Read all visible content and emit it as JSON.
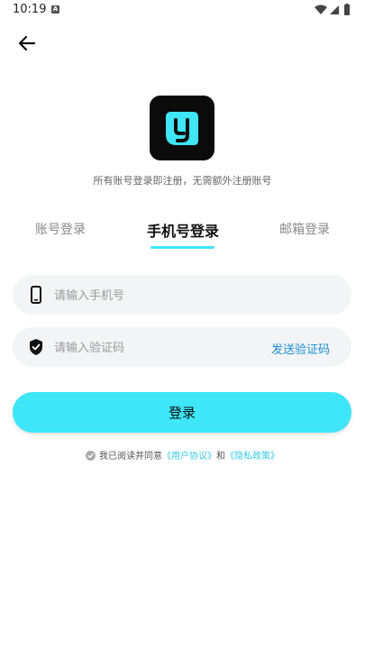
{
  "status_bar": {
    "time": "10:19",
    "notif_icon": "A"
  },
  "header": {
    "back_icon": "arrow-left-icon"
  },
  "logo": {
    "letter": "y",
    "brand_color": "#3ee6f7"
  },
  "subtitle": "所有账号登录即注册，无需额外注册账号",
  "tabs": [
    {
      "label": "账号登录",
      "active": false
    },
    {
      "label": "手机号登录",
      "active": true
    },
    {
      "label": "邮箱登录",
      "active": false
    }
  ],
  "phone_field": {
    "placeholder": "请输入手机号",
    "value": "",
    "icon": "phone-icon"
  },
  "code_field": {
    "placeholder": "请输入验证码",
    "value": "",
    "icon": "shield-icon",
    "send_label": "发送验证码"
  },
  "login_button": {
    "label": "登录"
  },
  "agreement": {
    "prefix": "我已阅读并同意",
    "user_agreement": "《用户协议》",
    "and": "和",
    "privacy_policy": "《隐私政策》"
  },
  "colors": {
    "accent": "#3ee6f7",
    "link": "#1e8fd4",
    "field_bg": "#f3f4f6"
  }
}
